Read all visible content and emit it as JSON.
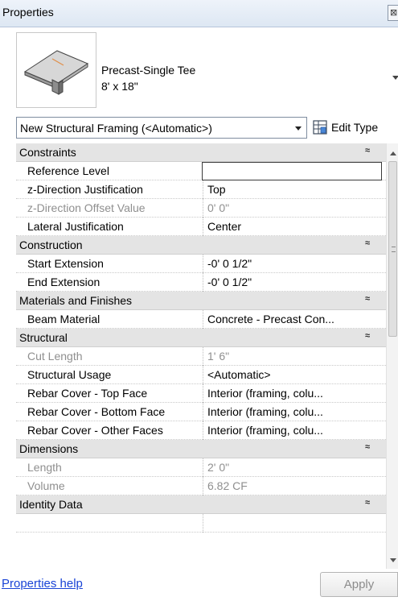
{
  "window": {
    "title": "Properties",
    "close_glyph": "⊠"
  },
  "type_selector": {
    "family": "Precast-Single Tee",
    "type": "8' x 18\"",
    "preview_icon": "precast-single-tee-preview"
  },
  "instance_selector": {
    "value": "New Structural Framing (<Automatic>)"
  },
  "edit_type": {
    "label": "Edit Type",
    "icon": "edit-type-icon"
  },
  "groups": [
    {
      "name": "Constraints",
      "collapse": "≈",
      "props": [
        {
          "name": "Reference Level",
          "value": "",
          "readonly": false,
          "editing": true
        },
        {
          "name": "z-Direction Justification",
          "value": "Top",
          "readonly": false
        },
        {
          "name": "z-Direction Offset Value",
          "value": "0'  0\"",
          "readonly": true
        },
        {
          "name": "Lateral Justification",
          "value": "Center",
          "readonly": false
        }
      ]
    },
    {
      "name": "Construction",
      "collapse": "≈",
      "props": [
        {
          "name": "Start Extension",
          "value": "-0'  0 1/2\"",
          "readonly": false
        },
        {
          "name": "End Extension",
          "value": "-0'  0 1/2\"",
          "readonly": false
        }
      ]
    },
    {
      "name": "Materials and Finishes",
      "collapse": "≈",
      "props": [
        {
          "name": "Beam Material",
          "value": "Concrete - Precast Con...",
          "readonly": false
        }
      ]
    },
    {
      "name": "Structural",
      "collapse": "≈",
      "props": [
        {
          "name": "Cut Length",
          "value": "1'  6\"",
          "readonly": true
        },
        {
          "name": "Structural Usage",
          "value": "<Automatic>",
          "readonly": false
        },
        {
          "name": "Rebar Cover - Top Face",
          "value": "Interior (framing, colu...",
          "readonly": false
        },
        {
          "name": "Rebar Cover - Bottom Face",
          "value": "Interior (framing, colu...",
          "readonly": false
        },
        {
          "name": "Rebar Cover - Other Faces",
          "value": "Interior (framing, colu...",
          "readonly": false
        }
      ]
    },
    {
      "name": "Dimensions",
      "collapse": "≈",
      "props": [
        {
          "name": "Length",
          "value": "2'  0\"",
          "readonly": true
        },
        {
          "name": "Volume",
          "value": "6.82 CF",
          "readonly": true
        }
      ]
    },
    {
      "name": "Identity Data",
      "collapse": "≈",
      "props": []
    }
  ],
  "footer": {
    "help_label": "Properties help",
    "apply_label": "Apply"
  }
}
